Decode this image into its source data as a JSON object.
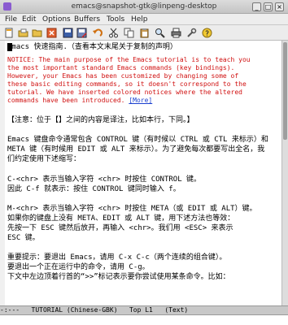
{
  "window": {
    "title": "emacs@snapshot-gtk@linpeng-desktop"
  },
  "menubar": {
    "items": [
      "File",
      "Edit",
      "Options",
      "Buffers",
      "Tools",
      "Help"
    ]
  },
  "toolbar": {
    "icons": [
      "new-file-icon",
      "open-file-icon",
      "open-directory-icon",
      "close-buffer-icon",
      "save-icon",
      "save-as-icon",
      "undo-icon",
      "cut-icon",
      "copy-icon",
      "paste-icon",
      "search-icon",
      "print-icon",
      "customize-icon",
      "help-icon"
    ]
  },
  "buffer": {
    "lines": [
      "Emacs 快速指南.（查看本文末尾关于复制的声明）",
      "NOTICE: The main purpose of the Emacs tutorial is to teach you",
      "the most important standard Emacs commands (key bindings).",
      "However, your Emacs has been customized by changing some of",
      "these basic editing commands, so it doesn't correspond to the",
      "tutorial.  We have inserted colored notices where the altered",
      "commands have been introduced.",
      "[More]",
      "【注意：位于【】之间的内容是译注，比如本行，下同。】",
      "Emacs 键盘命令通常包含 CONTROL 键（有时候以 CTRL 或 CTL 来标示）和",
      "META 键（有时候用 EDIT 或 ALT 来标示）。为了避免每次都要写出全名，我",
      "们约定使用下述缩写：",
      "C-<chr>  表示当输入字符 <chr> 时按住 CONTROL 键。",
      "        因此 C-f 就表示：按住 CONTROL 键同时输入 f。",
      "M-<chr>  表示当输入字符 <chr> 时按住 META（或 EDIT 或 ALT）键。",
      "        如果你的键盘上没有 META、EDIT 或 ALT 键，用下述方法也等效：",
      "        先按一下 ESC 键然后放开，再输入 <chr>。我们用 <ESC> 来表示",
      "        ESC 键。",
      "重要提示：要退出 Emacs，请用 C-x C-c（两个连续的组合键）。",
      "要退出一个正在运行中的命令，请用 C-g。",
      "下文中左边顶着行首的“>>”标记表示要你尝试使用某条命令。比如："
    ]
  },
  "modeline": {
    "status": "-:---",
    "buffer_name": "TUTORIAL (Chinese-GBK)",
    "position": "Top L1",
    "mode": "(Text)"
  }
}
